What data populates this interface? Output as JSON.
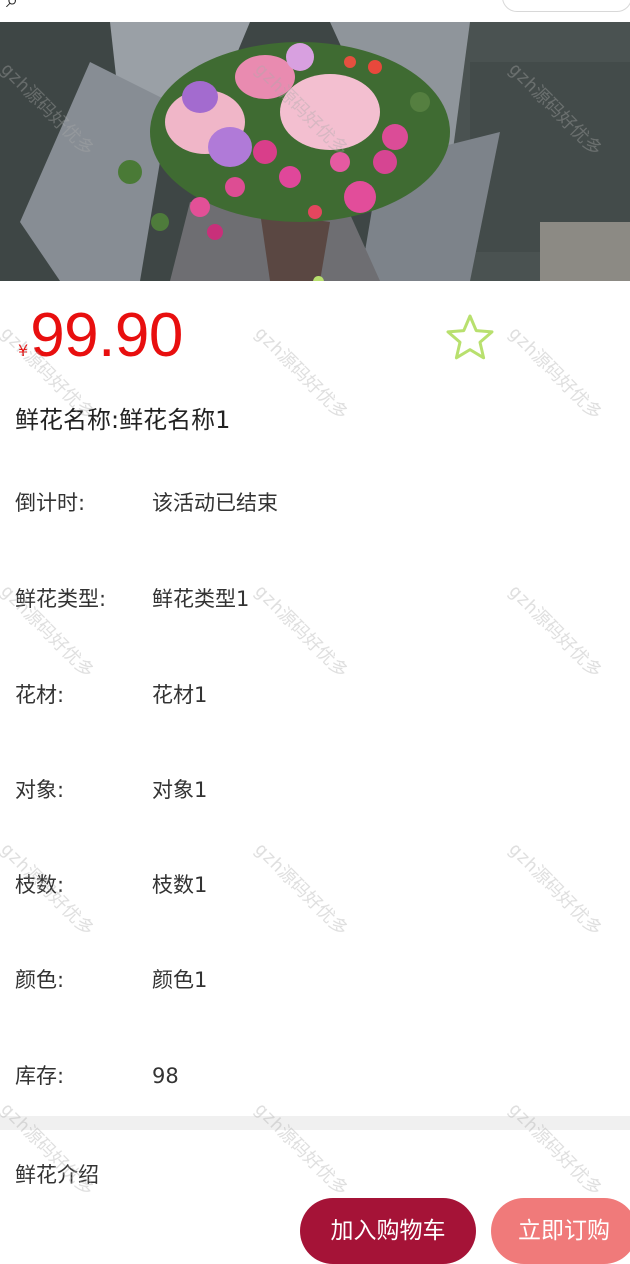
{
  "header": {
    "back_icon": "magnifier-like-back-glyph"
  },
  "banner": {
    "icon": "flower-bouquet-photo",
    "slide_count": 1,
    "active_slide": 1
  },
  "product": {
    "currency": "¥",
    "price": "99.90",
    "name_label": "鲜花名称:",
    "name_value": "鲜花名称1",
    "favorite_icon": "star-outline-icon"
  },
  "attributes": [
    {
      "label": "倒计时:",
      "value": "该活动已结束"
    },
    {
      "label": "鲜花类型:",
      "value": "鲜花类型1"
    },
    {
      "label": "花材:",
      "value": "花材1"
    },
    {
      "label": "对象:",
      "value": "对象1"
    },
    {
      "label": "枝数:",
      "value": "枝数1"
    },
    {
      "label": "颜色:",
      "value": "颜色1"
    },
    {
      "label": "库存:",
      "value": "98"
    }
  ],
  "intro": {
    "title": "鲜花介绍"
  },
  "actions": {
    "add_to_cart": "加入购物车",
    "buy_now": "立即订购"
  },
  "watermark": "gzh源码好优多",
  "colors": {
    "price": "#e80f0f",
    "cart_button": "#a51337",
    "buy_button": "#f07a7a",
    "star": "#b8e06e",
    "dot": "#b8e06e"
  }
}
